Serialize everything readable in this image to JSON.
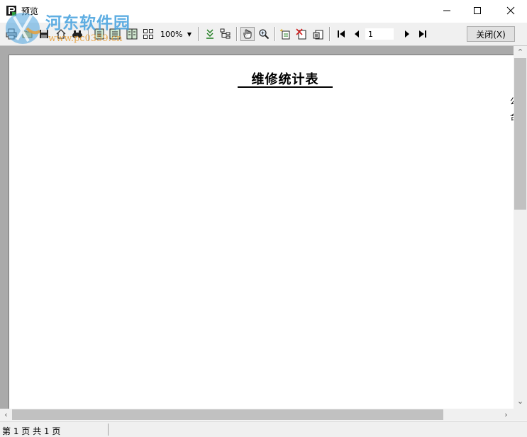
{
  "window": {
    "title": "预览"
  },
  "watermark": {
    "name": "河东软件园",
    "url": "www.pc0359.cn"
  },
  "toolbar": {
    "buttons": [
      {
        "id": "print",
        "icon": "print-icon"
      },
      {
        "id": "open",
        "icon": "open-folder-icon"
      },
      {
        "id": "save",
        "icon": "save-icon"
      },
      {
        "id": "export",
        "icon": "export-icon"
      },
      {
        "id": "find",
        "icon": "binoculars-icon"
      },
      {
        "id": "one-page",
        "icon": "single-page-icon"
      },
      {
        "id": "page-width",
        "icon": "page-width-icon"
      },
      {
        "id": "two-page",
        "icon": "two-page-icon"
      },
      {
        "id": "multi-page",
        "icon": "multi-page-icon"
      },
      {
        "id": "outline",
        "icon": "outline-icon"
      },
      {
        "id": "tree",
        "icon": "tree-icon"
      },
      {
        "id": "hand",
        "icon": "hand-icon"
      },
      {
        "id": "zoom",
        "icon": "zoom-icon"
      },
      {
        "id": "new-page",
        "icon": "new-page-icon"
      },
      {
        "id": "delete-page",
        "icon": "delete-page-icon"
      },
      {
        "id": "edit-page",
        "icon": "edit-page-icon"
      },
      {
        "id": "first",
        "icon": "first-page-icon"
      },
      {
        "id": "prev",
        "icon": "prev-page-icon"
      },
      {
        "id": "next",
        "icon": "next-page-icon"
      },
      {
        "id": "last",
        "icon": "last-page-icon"
      }
    ],
    "zoom_value": "100%",
    "page_number": "1",
    "close_label": "关闭(X)"
  },
  "report": {
    "title": "维修统计表",
    "edge_chars": [
      "公",
      "合"
    ]
  },
  "status": {
    "page_info": "第 1 页 共 1 页"
  }
}
